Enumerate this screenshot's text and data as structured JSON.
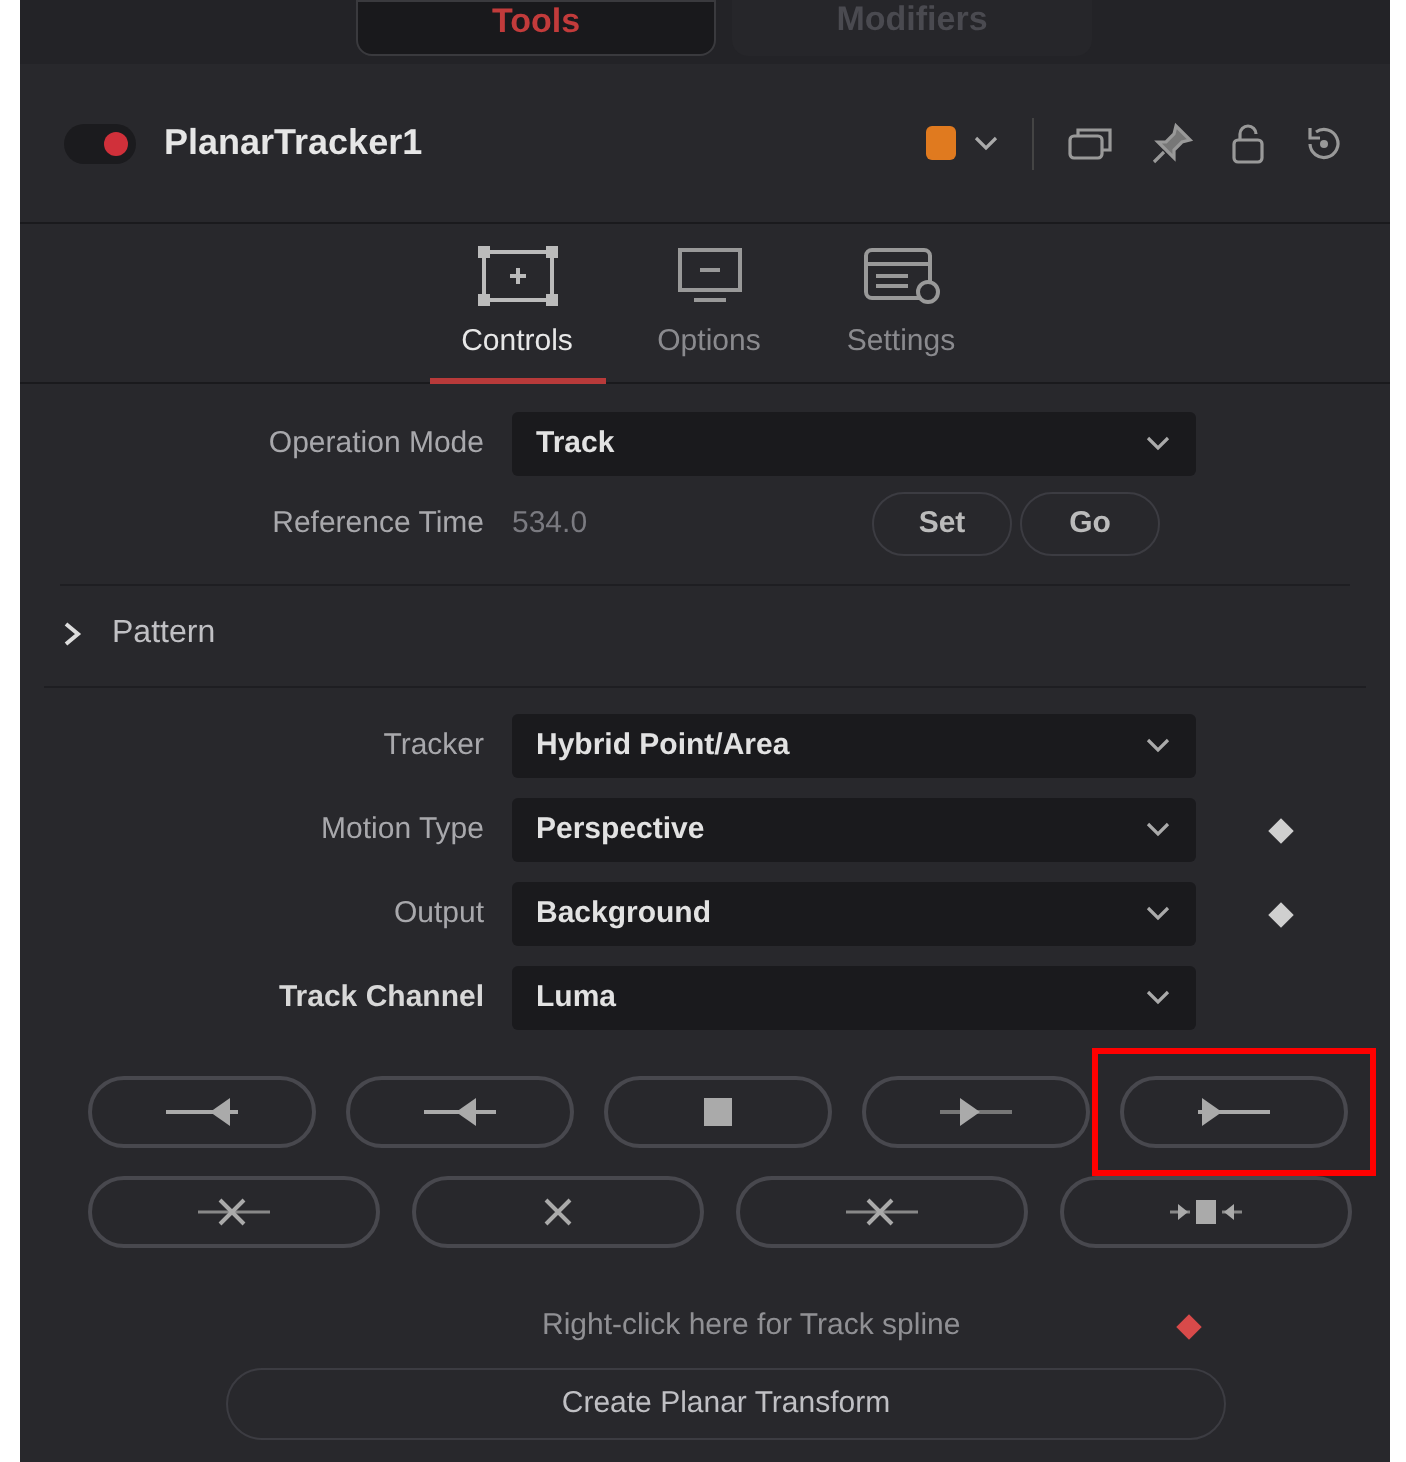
{
  "top_tabs": [
    {
      "label": "Tools",
      "selected": true
    },
    {
      "label": "Modifiers",
      "selected": false
    }
  ],
  "node": {
    "title": "PlanarTracker1",
    "enabled": true
  },
  "inspector_tabs": [
    {
      "label": "Controls",
      "kind": "controls",
      "selected": true
    },
    {
      "label": "Options",
      "kind": "options",
      "selected": false
    },
    {
      "label": "Settings",
      "kind": "settings",
      "selected": false
    }
  ],
  "operation_mode": {
    "label": "Operation Mode",
    "value": "Track"
  },
  "reference_time": {
    "label": "Reference Time",
    "value": "534.0",
    "buttons": [
      "Set",
      "Go"
    ]
  },
  "section": {
    "title": "Pattern",
    "expanded": false
  },
  "fields": [
    {
      "label": "Tracker",
      "value": "Hybrid Point/Area",
      "keyframe": false,
      "bold_label": false
    },
    {
      "label": "Motion Type",
      "value": "Perspective",
      "keyframe": true,
      "bold_label": false
    },
    {
      "label": "Output",
      "value": "Background",
      "keyframe": true,
      "bold_label": false
    },
    {
      "label": "Track Channel",
      "value": "Luma",
      "keyframe": false,
      "bold_label": true
    }
  ],
  "track_buttons": [
    {
      "kind": "to-start",
      "highlighted": false
    },
    {
      "kind": "step-back",
      "highlighted": false
    },
    {
      "kind": "stop",
      "highlighted": false
    },
    {
      "kind": "step-forward",
      "highlighted": false
    },
    {
      "kind": "to-end",
      "highlighted": true
    }
  ],
  "delete_buttons": [
    {
      "kind": "clear-left"
    },
    {
      "kind": "clear-all"
    },
    {
      "kind": "clear-right"
    },
    {
      "kind": "trim"
    }
  ],
  "spline_hint": "Right-click here for Track spline",
  "create_button": "Create Planar Transform"
}
